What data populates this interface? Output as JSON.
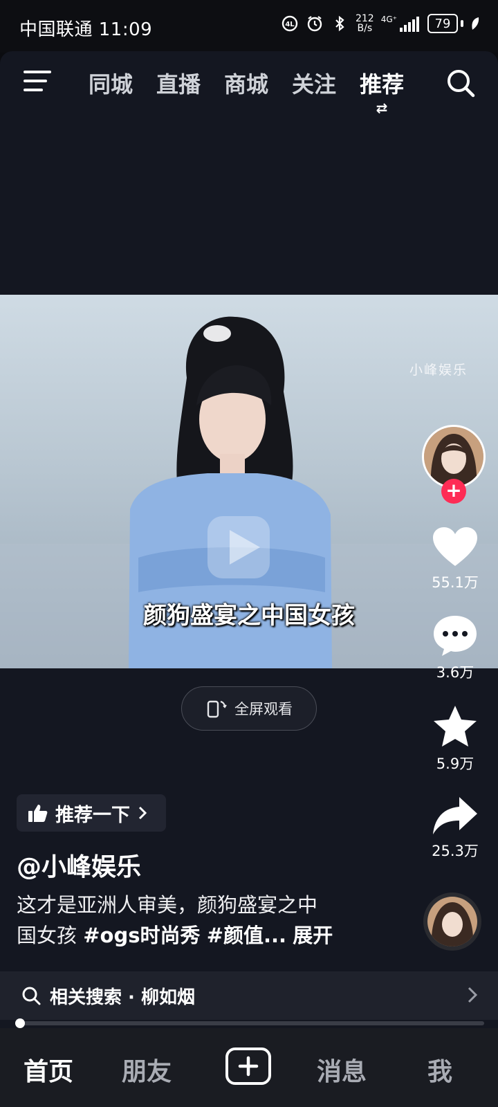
{
  "status_bar": {
    "carrier_time": "中国联通 11:09",
    "net_speed_top": "212",
    "net_speed_bottom": "B/s",
    "network_type": "4G⁺",
    "battery": "79"
  },
  "top_nav": {
    "tabs": [
      "同城",
      "直播",
      "商城",
      "关注",
      "推荐"
    ],
    "active_tab": "推荐",
    "swap_glyph": "⇄"
  },
  "video": {
    "watermark": "小峰娱乐",
    "subtitle": "颜狗盛宴之中国女孩"
  },
  "fullscreen_button": {
    "label": "全屏观看"
  },
  "actions": {
    "likes": "55.1万",
    "comments": "3.6万",
    "favorites": "5.9万",
    "shares": "25.3万"
  },
  "recommend_pill": {
    "label": "推荐一下"
  },
  "post": {
    "author": "@小峰娱乐",
    "desc_line1": "这才是亚洲人审美，颜狗盛宴之中",
    "desc_line2_prefix": "国女孩 ",
    "hashtag1": "#ogs时尚秀",
    "hashtag2": "#颜值...",
    "expand": "展开"
  },
  "related_search": {
    "label": "相关搜索 · 柳如烟"
  },
  "playback": {
    "progress": 0.01
  },
  "bottom_nav": {
    "home": "首页",
    "friends": "朋友",
    "messages": "消息",
    "me": "我"
  },
  "colors": {
    "accent": "#fe2c55",
    "background": "#141721"
  }
}
